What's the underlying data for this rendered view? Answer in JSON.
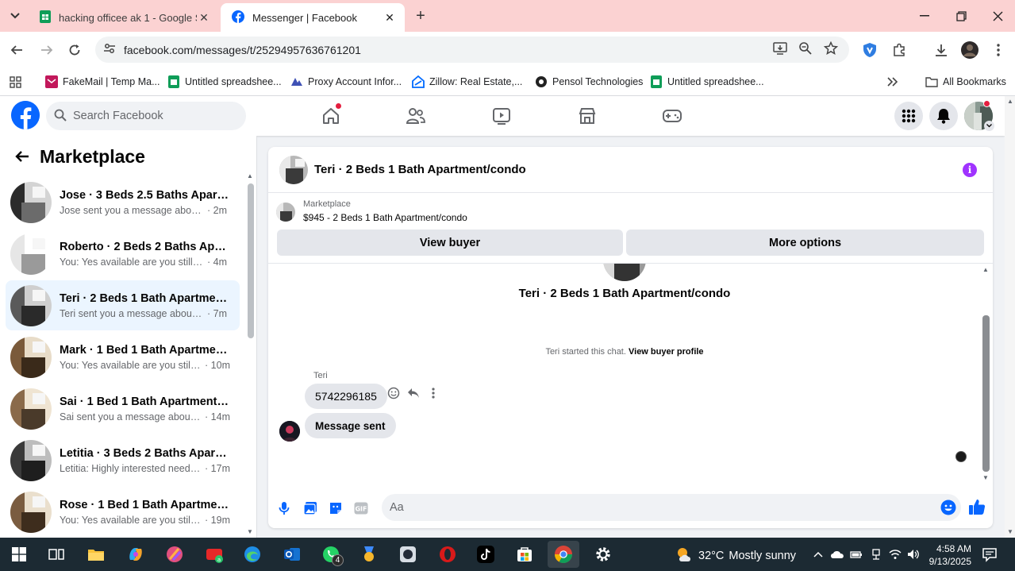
{
  "browser": {
    "tabs": [
      {
        "title": "hacking officee ak 1 - Google Sl",
        "active": false,
        "icon": "sheets-icon"
      },
      {
        "title": "Messenger | Facebook",
        "active": true,
        "icon": "facebook-icon"
      }
    ],
    "url": "facebook.com/messages/t/25294957636761201",
    "bookmarks": [
      {
        "label": "FakeMail | Temp Ma...",
        "icon": "fakemail-icon"
      },
      {
        "label": "Untitled spreadshee...",
        "icon": "sheets-icon"
      },
      {
        "label": "Proxy Account Infor...",
        "icon": "proxy-icon"
      },
      {
        "label": "Zillow: Real Estate,...",
        "icon": "zillow-icon"
      },
      {
        "label": "Pensol Technologies",
        "icon": "pensol-icon"
      },
      {
        "label": "Untitled spreadshee...",
        "icon": "sheets-icon"
      }
    ],
    "all_bookmarks_label": "All Bookmarks"
  },
  "facebook": {
    "search_placeholder": "Search Facebook",
    "sidebar": {
      "title": "Marketplace",
      "conversations": [
        {
          "name": "Jose · 3 Beds 2.5 Baths Apartme...",
          "snippet": "Jose sent you a message about yo...",
          "time": "· 2m",
          "selected": false
        },
        {
          "name": "Roberto · 2 Beds 2 Baths Apart...",
          "snippet": "You: Yes available are you still inter...",
          "time": "· 4m",
          "selected": false
        },
        {
          "name": "Teri · 2 Beds 1 Bath Apartment/c...",
          "snippet": "Teri sent you a message about yo...",
          "time": "· 7m",
          "selected": true
        },
        {
          "name": "Mark · 1 Bed 1 Bath Apartment/...",
          "snippet": "You: Yes available are you still int...",
          "time": "· 10m",
          "selected": false
        },
        {
          "name": "Sai · 1 Bed 1 Bath Apartment/co...",
          "snippet": "Sai sent you a message about yo...",
          "time": "· 14m",
          "selected": false
        },
        {
          "name": "Letitia · 3 Beds 2 Baths Apartme...",
          "snippet": "Letitia: Highly interested need to ...",
          "time": "· 17m",
          "selected": false
        },
        {
          "name": "Rose · 1 Bed 1 Bath Apartment/c...",
          "snippet": "You: Yes available are you still int...",
          "time": "· 19m",
          "selected": false
        }
      ]
    },
    "chat": {
      "title": "Teri · 2 Beds 1 Bath Apartment/condo",
      "listing_category": "Marketplace",
      "listing_price": "$945 - 2 Beds 1 Bath Apartment/condo",
      "view_buyer_label": "View buyer",
      "more_options_label": "More options",
      "conversation_title": "Teri · 2 Beds 1 Bath Apartment/condo",
      "started_text": "Teri started this chat.",
      "view_profile_label": "View buyer profile",
      "sender_name": "Teri",
      "messages": [
        {
          "text": "5742296185"
        },
        {
          "text": "Message sent"
        }
      ],
      "composer_placeholder": "Aa"
    }
  },
  "taskbar": {
    "weather_temp": "32°C",
    "weather_condition": "Mostly sunny",
    "time": "4:58 AM",
    "date": "9/13/2025",
    "whatsapp_badge": "4"
  },
  "colors": {
    "fb_blue": "#0866ff",
    "tab_strip": "#fbd2d2",
    "selected_conv": "#ebf5ff",
    "taskbar": "#1c2a33"
  }
}
